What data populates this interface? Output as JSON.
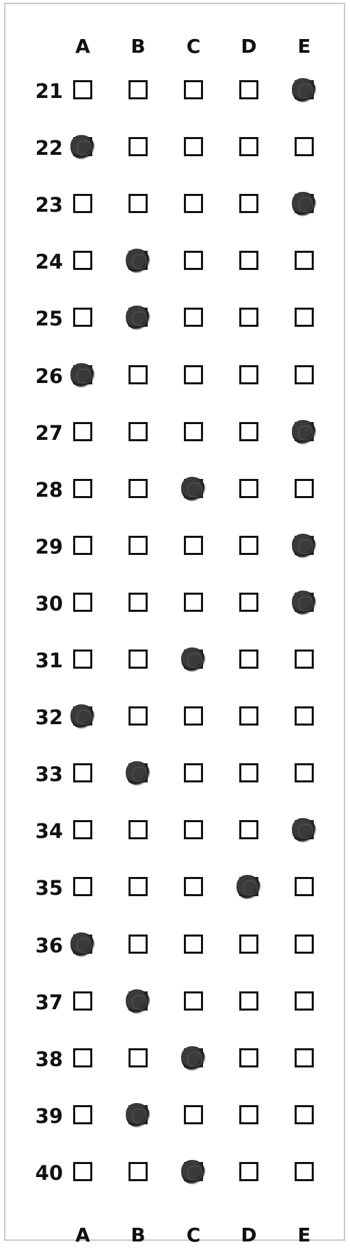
{
  "columns": [
    "A",
    "B",
    "C",
    "D",
    "E"
  ],
  "rows": [
    {
      "number": "21",
      "marked": "E"
    },
    {
      "number": "22",
      "marked": "A"
    },
    {
      "number": "23",
      "marked": "E"
    },
    {
      "number": "24",
      "marked": "B"
    },
    {
      "number": "25",
      "marked": "B"
    },
    {
      "number": "26",
      "marked": "A"
    },
    {
      "number": "27",
      "marked": "E"
    },
    {
      "number": "28",
      "marked": "C"
    },
    {
      "number": "29",
      "marked": "E"
    },
    {
      "number": "30",
      "marked": "E"
    },
    {
      "number": "31",
      "marked": "C"
    },
    {
      "number": "32",
      "marked": "A"
    },
    {
      "number": "33",
      "marked": "B"
    },
    {
      "number": "34",
      "marked": "E"
    },
    {
      "number": "35",
      "marked": "D"
    },
    {
      "number": "36",
      "marked": "A"
    },
    {
      "number": "37",
      "marked": "B"
    },
    {
      "number": "38",
      "marked": "C"
    },
    {
      "number": "39",
      "marked": "B"
    },
    {
      "number": "40",
      "marked": "C"
    }
  ]
}
